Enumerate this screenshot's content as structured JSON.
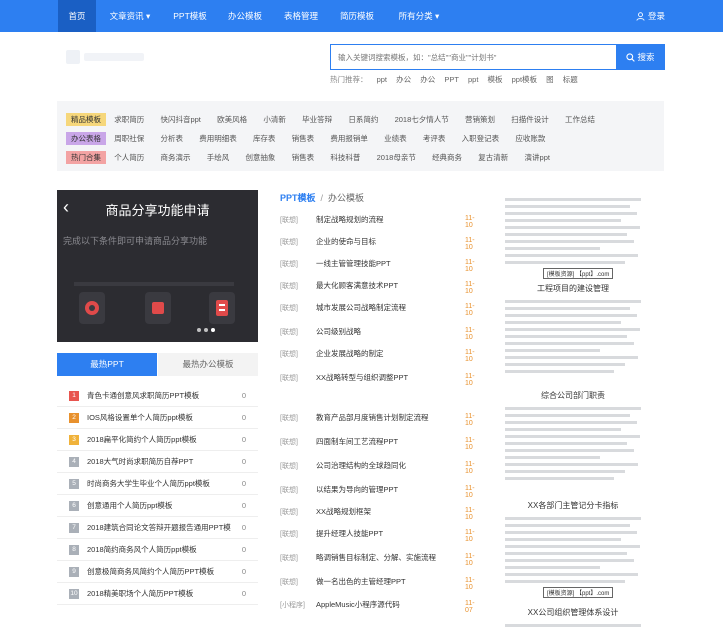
{
  "nav": {
    "items": [
      "首页",
      "文章资讯",
      "PPT模板",
      "办公模板",
      "表格管理",
      "简历模板",
      "所有分类"
    ],
    "login": "登录"
  },
  "search": {
    "placeholder": "输入关键词搜索模板，如：\"总结\"\"商业\"\"计划书\"",
    "button": "搜索",
    "hot_label": "热门推荐：",
    "hot_keywords": [
      "ppt",
      "办公",
      "办公",
      "PPT",
      "ppt",
      "模板",
      "ppt模板",
      "图",
      "标题"
    ]
  },
  "categories": [
    {
      "tag": "精品模板",
      "tag_color": "#f6d77b",
      "links": [
        "求职简历",
        "快闪抖音ppt",
        "欧美风格",
        "小清新",
        "毕业答辩",
        "日系简约",
        "2018七夕情人节",
        "营销策划",
        "扫描件设计",
        "工作总结"
      ]
    },
    {
      "tag": "办公表格",
      "tag_color": "#c9a6e8",
      "links": [
        "周职社保",
        "分析表",
        "费用明细表",
        "库存表",
        "销售表",
        "费用报销单",
        "业绩表",
        "考评表",
        "入职登记表",
        "应收账款"
      ]
    },
    {
      "tag": "热门合集",
      "tag_color": "#f3a3a3",
      "links": [
        "个人简历",
        "商务演示",
        "手绘风",
        "创意抽象",
        "销售表",
        "科技科普",
        "2018母亲节",
        "经典商务",
        "复古清新",
        "演讲ppt"
      ]
    }
  ],
  "banner": {
    "title": "商品分享功能申请",
    "subtitle": "完成以下条件即可申请商品分享功能"
  },
  "tabs": [
    "最热PPT",
    "最热办公模板"
  ],
  "hot_list": [
    {
      "num": "1",
      "color": "#e8554f",
      "text": "青色卡通创意风求职简历PPT模板",
      "count": "0"
    },
    {
      "num": "2",
      "color": "#e8912d",
      "text": "IOS风格设置单个人简历ppt模板",
      "count": "0"
    },
    {
      "num": "3",
      "color": "#f0b23a",
      "text": "2018扁平化简约个人简历ppt模板",
      "count": "0"
    },
    {
      "num": "4",
      "color": "#aab0b8",
      "text": "2018大气时尚求职简历自荐PPT",
      "count": "0"
    },
    {
      "num": "5",
      "color": "#aab0b8",
      "text": "时尚商务大学生毕业个人简历ppt模板",
      "count": "0"
    },
    {
      "num": "6",
      "color": "#aab0b8",
      "text": "创意通用个人简历ppt模板",
      "count": "0"
    },
    {
      "num": "7",
      "color": "#aab0b8",
      "text": "2018建筑合同论文答辩开题报告通用PPT模",
      "count": "0"
    },
    {
      "num": "8",
      "color": "#aab0b8",
      "text": "2018简约商务风个人简历ppt模板",
      "count": "0"
    },
    {
      "num": "9",
      "color": "#aab0b8",
      "text": "创意极简商务风简约个人简历PPT模板",
      "count": "0"
    },
    {
      "num": "10",
      "color": "#aab0b8",
      "text": "2018精美职场个人简历PPT模板",
      "count": "0"
    }
  ],
  "crumb": {
    "root": "PPT模板",
    "sep": "/",
    "current": "办公模板"
  },
  "articles": [
    {
      "tag": "[联想]",
      "title": "制定战略规划的流程",
      "date": "11-10"
    },
    {
      "tag": "[联想]",
      "title": "企业的使命与目标",
      "date": "11-10"
    },
    {
      "tag": "[联想]",
      "title": "一线主管管理技能PPT",
      "date": "11-10"
    },
    {
      "tag": "[联想]",
      "title": "最大化顾客满意技术PPT",
      "date": "11-10"
    },
    {
      "tag": "[联想]",
      "title": "城市发展公司战略制定流程",
      "date": "11-10"
    },
    {
      "tag": "[联想]",
      "title": "公司级别战略",
      "date": "11-10"
    },
    {
      "tag": "[联想]",
      "title": "企业发展战略的制定",
      "date": "11-10"
    },
    {
      "tag": "[联想]",
      "title": "XX战略转型与组织调整PPT",
      "date": "11-10"
    },
    {
      "tag": "[联想]",
      "title": "教育产品部月度销售计划制定流程",
      "date": "11-10"
    },
    {
      "tag": "[联想]",
      "title": "四面制车间工艺流程PPT",
      "date": "11-10"
    },
    {
      "tag": "[联想]",
      "title": "公司治理结构的全球趋同化",
      "date": "11-10"
    },
    {
      "tag": "[联想]",
      "title": "以结果为导向的管理PPT",
      "date": "11-10"
    },
    {
      "tag": "[联想]",
      "title": "XX战略规划框架",
      "date": "11-10"
    },
    {
      "tag": "[联想]",
      "title": "提升经理人技能PPT",
      "date": "11-10"
    },
    {
      "tag": "[联想]",
      "title": "略调销售目标制定、分解、实施流程",
      "date": "11-10"
    },
    {
      "tag": "[联想]",
      "title": "做一名出色的主管经理PPT",
      "date": "11-10"
    },
    {
      "tag": "[小程序]",
      "title": "AppleMusic小程序源代码",
      "date": "11-07"
    }
  ],
  "docs": [
    {
      "title": "",
      "stamp": "[模板资源] 【ppt】.com"
    },
    {
      "title": "工程项目的建设管理",
      "stamp": ""
    },
    {
      "title": "综合公司部门职责",
      "stamp": ""
    },
    {
      "title": "XX各部门主管记分卡指标",
      "stamp": "[模板资源] 【ppt】.com"
    },
    {
      "title": "XX公司组织管理体系设计",
      "stamp": ""
    }
  ]
}
